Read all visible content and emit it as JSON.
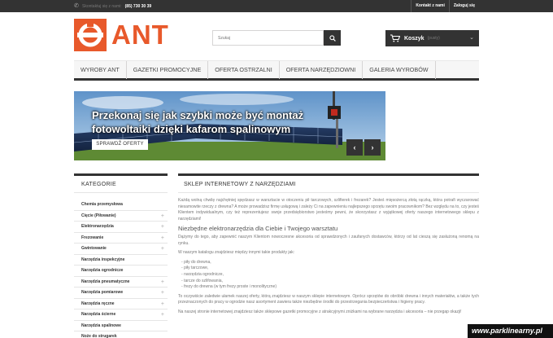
{
  "topbar": {
    "contact_prefix": "Skontaktuj się z nami:",
    "phone": "(85) 730 30 39",
    "links": [
      "Kontakt z nami",
      "Zaloguj się"
    ]
  },
  "header": {
    "logo_text": "ANT",
    "search_placeholder": "Szukaj",
    "cart_label": "Koszyk",
    "cart_empty": "(pusty)"
  },
  "nav": {
    "items": [
      "WYROBY ANT",
      "GAZETKI PROMOCYJNE",
      "OFERTA OSTRZALNI",
      "OFERTA NARZĘDZIOWNI",
      "GALERIA WYROBÓW"
    ]
  },
  "slider": {
    "headline_1": "Przekonaj się jak szybki może być montaż",
    "headline_2": "fotowoltaiki dzięki kafarom spalinowym",
    "cta": "SPRAWDŹ OFERTY",
    "prev": "‹",
    "next": "›"
  },
  "sidebar": {
    "title": "KATEGORIE",
    "items": [
      {
        "label": "Chemia przemysłowa",
        "expandable": false
      },
      {
        "label": "Cięcie (Piłowanie)",
        "expandable": true
      },
      {
        "label": "Elektronarzędzia",
        "expandable": true
      },
      {
        "label": "Frezowanie",
        "expandable": true
      },
      {
        "label": "Gwintowanie",
        "expandable": true
      },
      {
        "label": "Narzędzia inspekcyjne",
        "expandable": false
      },
      {
        "label": "Narzędzia ogrodnicze",
        "expandable": false
      },
      {
        "label": "Narzędzia pneumatyczne",
        "expandable": true
      },
      {
        "label": "Narzędzia pomiarowe",
        "expandable": true
      },
      {
        "label": "Narzędzia ręczne",
        "expandable": true
      },
      {
        "label": "Narzędzia ścierne",
        "expandable": true
      },
      {
        "label": "Narzędzia spalinowe",
        "expandable": false
      },
      {
        "label": "Noże do strugarek",
        "expandable": false
      }
    ]
  },
  "main": {
    "title": "SKLEP INTERNETOWY Z NARZĘDZIAMI",
    "p1": "Każdą wolną chwilę najchętniej spędzasz w warsztacie w otoczeniu pił tarczowych, szlifierek i frezarek? Jesteś mięsożercą złotą rączką, która potrafi wyczarować niesamowite rzeczy z drewna? A może prowadzisz firmę usługową i zależy Ci na zapewnieniu najlepszego sprzętu swoim pracownikom? Bez względu na to, czy jesteś Klientem indywidualnym, czy też reprezentujesz swoje przedsiębiorstwo jesteśmy pewni, że skorzystasz z wyjątkowej oferty naszego internetowego sklepu z narzędziami!",
    "h1": "Niezbędne elektronarzędzia dla Ciebie i Twojego warsztatu",
    "p2": "Dążymy do tego, aby zapewnić naszym Klientom nowoczesne akcesoria od sprawdzonych i zaufanych dostawców, którzy od lat cieszą się zasłużoną renomą na rynku.",
    "p3": "W naszym katalogu znajdziesz między innymi takie produkty jak:",
    "list": [
      "piły do drewna,",
      "piły tarczowe,",
      "narzędzia ogrodnicze,",
      "tarcze do szlifowania,",
      "frezy do drewna (w tym frezy proste i monolityczne)"
    ],
    "p4": "To oczywiście zaledwie ułamek naszej oferty, którą znajdziesz w naszym sklepie internetowym. Oprócz sprzętów do obróbki drewna i innych materiałów, a także tych przeznaczonych do pracy w ogrodzie nasz asortyment zawiera także niezbędne środki do przestrzegania bezpieczeństwa i higieny pracy.",
    "p5": "Na naszej stronie internetowej znajdziesz także sklepowe gazetki promocyjne z atrakcyjnymi zniżkami na wybrane narzędzia i akcesoria – nie przegap okazji!"
  },
  "watermark": "www.parklinearny.pl",
  "colors": {
    "brand": "#e8592b",
    "dark": "#333333"
  }
}
